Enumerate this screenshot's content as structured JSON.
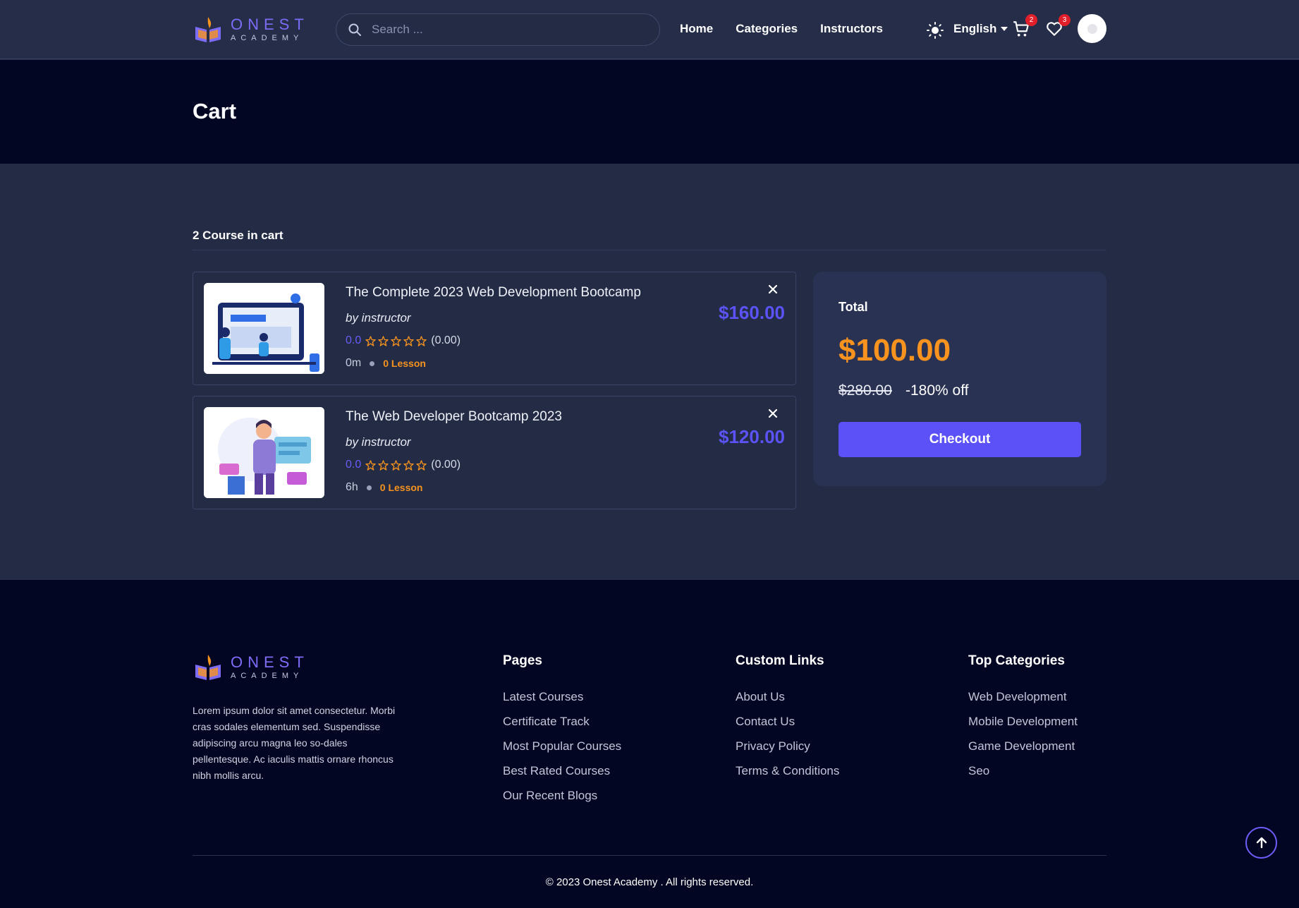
{
  "header": {
    "logo_name": "ONEST",
    "logo_sub": "ACADEMY",
    "search_placeholder": "Search ...",
    "nav": [
      "Home",
      "Categories",
      "Instructors"
    ],
    "language": "English",
    "cart_badge": "2",
    "wishlist_badge": "3"
  },
  "page": {
    "title": "Cart"
  },
  "cart": {
    "count_label": "2 Course in cart",
    "items": [
      {
        "title": "The Complete 2023 Web Development Bootcamp",
        "by": "by instructor",
        "rating": "0.0",
        "rating_count": "(0.00)",
        "duration": "0m",
        "lessons": "0 Lesson",
        "price": "$160.00"
      },
      {
        "title": "The Web Developer Bootcamp 2023",
        "by": "by instructor",
        "rating": "0.0",
        "rating_count": "(0.00)",
        "duration": "6h",
        "lessons": "0 Lesson",
        "price": "$120.00"
      }
    ]
  },
  "summary": {
    "label": "Total",
    "total": "$100.00",
    "original": "$280.00",
    "discount": "-180% off",
    "checkout_label": "Checkout"
  },
  "footer": {
    "description": "Lorem ipsum dolor sit amet consectetur. Morbi cras sodales elementum sed. Suspendisse adipiscing arcu magna leo so-dales pellentesque. Ac iaculis mattis ornare rhoncus nibh mollis arcu.",
    "columns": [
      {
        "title": "Pages",
        "links": [
          "Latest Courses",
          "Certificate Track",
          "Most Popular Courses",
          "Best Rated Courses",
          "Our Recent Blogs"
        ]
      },
      {
        "title": "Custom Links",
        "links": [
          "About Us",
          "Contact Us",
          "Privacy Policy",
          "Terms & Conditions"
        ]
      },
      {
        "title": "Top Categories",
        "links": [
          "Web Development",
          "Mobile Development",
          "Game Development",
          "Seo"
        ]
      }
    ],
    "copyright": "© 2023 Onest Academy . All rights reserved."
  },
  "colors": {
    "accent": "#5c50f7",
    "price_orange": "#f7931e",
    "background": "#232b45",
    "dark_band": "#030622"
  },
  "icons": [
    "search-icon",
    "sun-icon",
    "chevron-down-icon",
    "cart-icon",
    "heart-icon",
    "close-icon",
    "star-icon",
    "arrow-up-icon"
  ]
}
